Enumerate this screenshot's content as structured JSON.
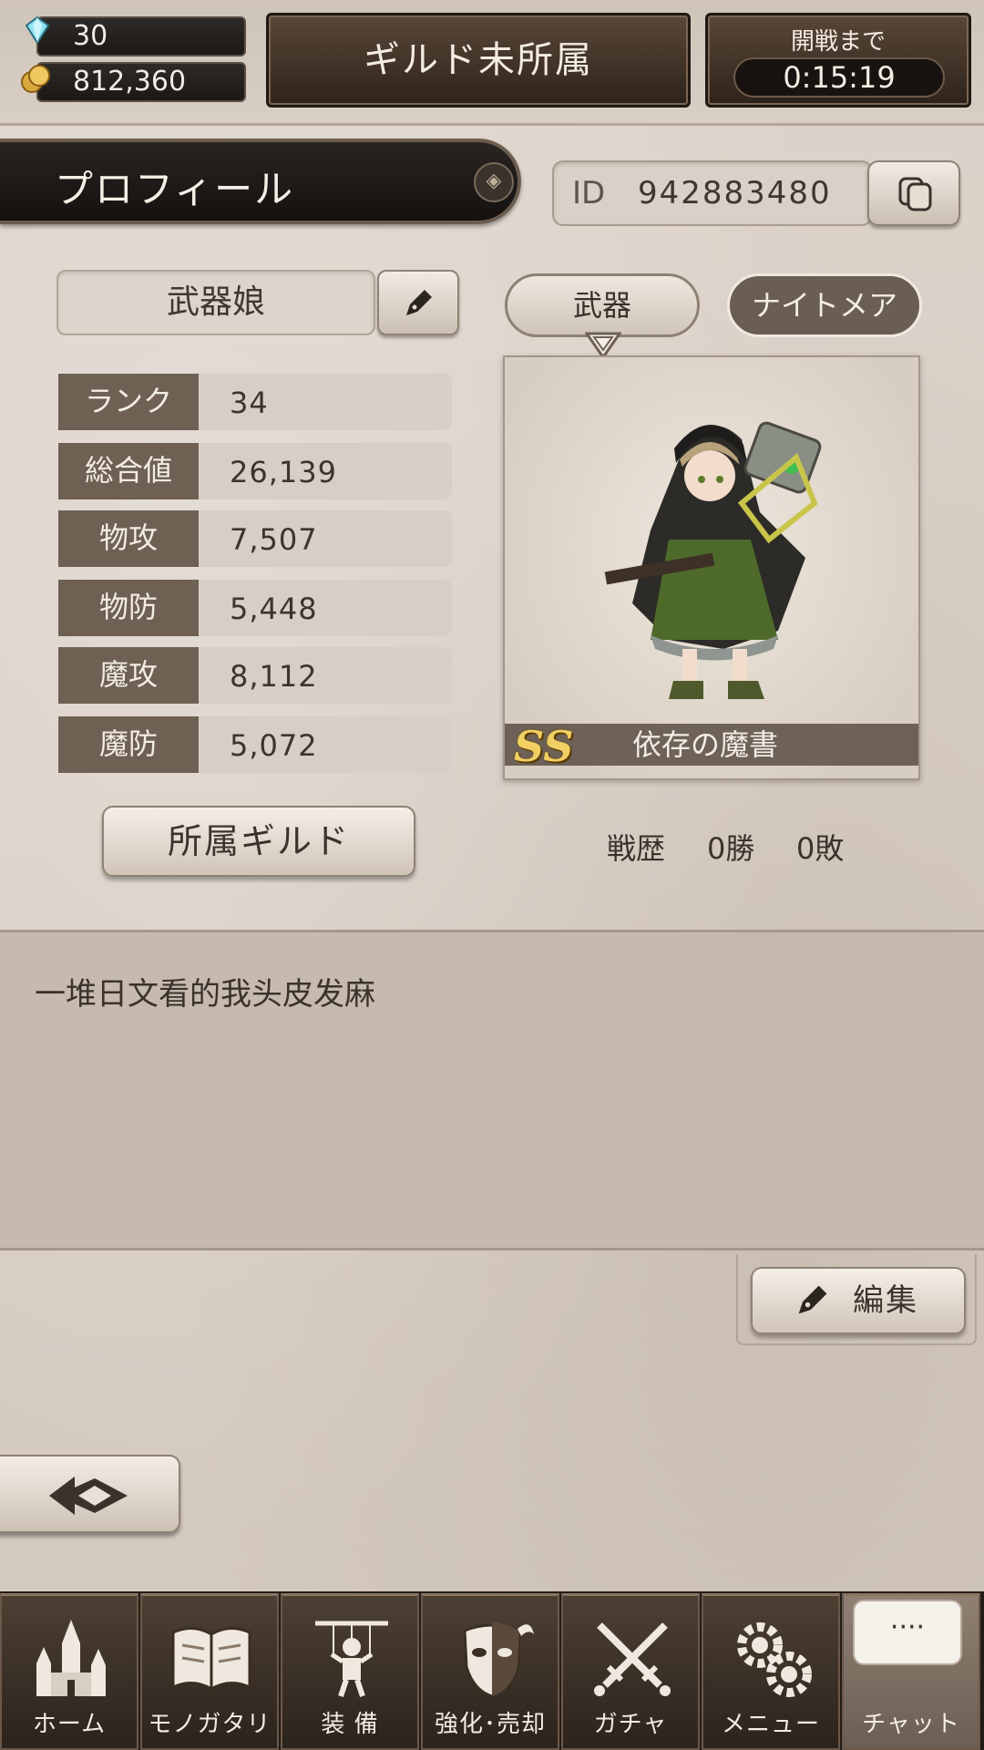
{
  "currency": {
    "gems": "30",
    "coins": "812,360"
  },
  "header": {
    "guild_status": "ギルド未所属",
    "battle_label": "開戦まで",
    "battle_timer": "0:15:19"
  },
  "profile": {
    "title": "プロフィール",
    "id_label": "ID",
    "id_value": "942883480",
    "name": "武器娘",
    "stats": [
      {
        "label": "ランク",
        "value": "34"
      },
      {
        "label": "総合値",
        "value": "26,139"
      },
      {
        "label": "物攻",
        "value": "7,507"
      },
      {
        "label": "物防",
        "value": "5,448"
      },
      {
        "label": "魔攻",
        "value": "8,112"
      },
      {
        "label": "魔防",
        "value": "5,072"
      }
    ],
    "guild_button": "所属ギルド",
    "tabs": {
      "weapon": "武器",
      "nightmare": "ナイトメア"
    },
    "weapon": {
      "rarity": "SS",
      "name": "依存の魔書"
    },
    "record": {
      "label": "戦歴",
      "wins": "0勝",
      "losses": "0敗"
    },
    "comment": "一堆日文看的我头皮发麻",
    "edit_button": "編集"
  },
  "nav": [
    {
      "label": "ホーム",
      "icon": "castle-icon"
    },
    {
      "label": "モノガタリ",
      "icon": "book-icon"
    },
    {
      "label": "装 備",
      "icon": "puppet-icon"
    },
    {
      "label": "強化･売却",
      "icon": "mask-icon"
    },
    {
      "label": "ガチャ",
      "icon": "swords-icon"
    },
    {
      "label": "メニュー",
      "icon": "gears-icon"
    },
    {
      "label": "チャット",
      "icon": "chat-icon",
      "bubble": "····"
    }
  ],
  "colors": {
    "accent_dark": "#2d2219",
    "panel": "#c6b9ae",
    "rarity_gold": "#f1cf63"
  }
}
